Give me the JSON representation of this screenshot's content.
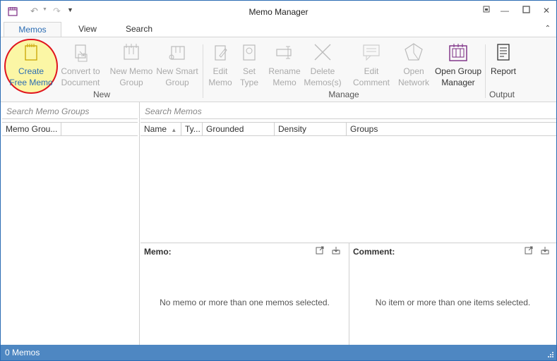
{
  "window": {
    "title": "Memo Manager"
  },
  "tabs": [
    {
      "label": "Memos",
      "active": true
    },
    {
      "label": "View",
      "active": false
    },
    {
      "label": "Search",
      "active": false
    }
  ],
  "ribbon": {
    "groups": {
      "new": "New",
      "manage": "Manage",
      "output": "Output"
    },
    "buttons": {
      "create_free_memo": "Create\nFree Memo",
      "create_free_memo_l1": "Create",
      "create_free_memo_l2": "Free Memo",
      "convert_l1": "Convert to",
      "convert_l2": "Document",
      "new_memo_group_l1": "New Memo",
      "new_memo_group_l2": "Group",
      "new_smart_group_l1": "New Smart",
      "new_smart_group_l2": "Group",
      "edit_memo_l1": "Edit",
      "edit_memo_l2": "Memo",
      "set_type_l1": "Set",
      "set_type_l2": "Type",
      "rename_memo_l1": "Rename",
      "rename_memo_l2": "Memo",
      "delete_memos_l1": "Delete",
      "delete_memos_l2": "Memos(s)",
      "edit_comment_l1": "Edit",
      "edit_comment_l2": "Comment",
      "open_network_l1": "Open",
      "open_network_l2": "Network",
      "open_group_manager_l1": "Open Group",
      "open_group_manager_l2": "Manager",
      "report": "Report"
    }
  },
  "left_panel": {
    "search_placeholder": "Search Memo Groups",
    "columns": [
      "Memo Grou..."
    ]
  },
  "right_panel": {
    "search_placeholder": "Search Memos",
    "columns": [
      "Name",
      "Ty...",
      "Grounded",
      "Density",
      "Groups"
    ],
    "sort_column": "Name"
  },
  "memo_pane": {
    "title": "Memo:",
    "message": "No memo or more than one memos selected."
  },
  "comment_pane": {
    "title": "Comment:",
    "message": "No item or more than one items selected."
  },
  "status": {
    "text": "0 Memos"
  },
  "colors": {
    "accent": "#2b6cb3",
    "statusbar": "#4e87c2",
    "highlight_fill": "#fbf6a5",
    "highlight_ring": "#e0141e",
    "purple_icon": "#7a2a82"
  }
}
